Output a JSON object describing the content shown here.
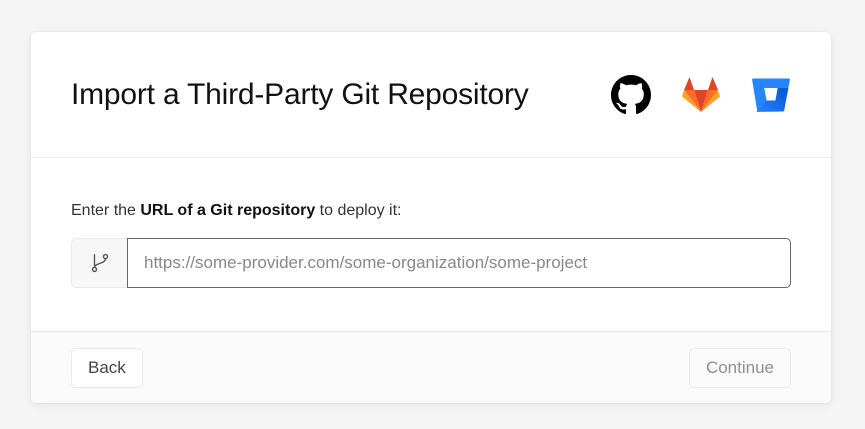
{
  "modal": {
    "title": "Import a Third-Party Git Repository",
    "providers": [
      {
        "name": "GitHub",
        "icon": "github-icon"
      },
      {
        "name": "GitLab",
        "icon": "gitlab-icon"
      },
      {
        "name": "Bitbucket",
        "icon": "bitbucket-icon"
      }
    ],
    "instruction": {
      "prefix": "Enter the ",
      "emphasis": "URL of a Git repository",
      "suffix": " to deploy it:"
    },
    "url_input": {
      "value": "",
      "placeholder": "https://some-provider.com/some-organization/some-project",
      "prefix_icon": "git-branch-icon"
    },
    "footer": {
      "back_label": "Back",
      "continue_label": "Continue",
      "continue_disabled": true
    }
  },
  "colors": {
    "github": "#000000",
    "gitlab_orange": "#E24329",
    "gitlab_light": "#FCA326",
    "gitlab_mid": "#FC6D26",
    "bitbucket": "#2684FF",
    "bitbucket_dark": "#0052CC"
  }
}
